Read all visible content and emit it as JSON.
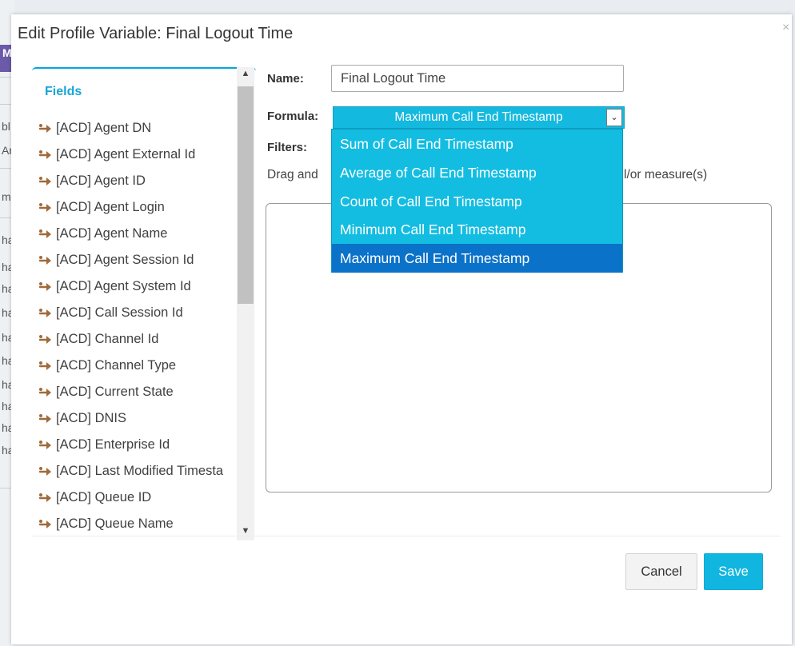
{
  "background": {
    "peek_texts": [
      "M",
      "bl",
      "Ar",
      "m",
      "ha",
      "ha",
      "ha",
      "ha",
      "ha",
      "ha",
      "ha",
      "ha",
      "ha",
      "ha"
    ]
  },
  "dialog": {
    "title": "Edit Profile Variable: Final Logout Time",
    "close_glyph": "×"
  },
  "fields": {
    "header": "Fields",
    "items": [
      "[ACD] Agent DN",
      "[ACD] Agent External Id",
      "[ACD] Agent ID",
      "[ACD] Agent Login",
      "[ACD] Agent Name",
      "[ACD] Agent Session Id",
      "[ACD] Agent System Id",
      "[ACD] Call Session Id",
      "[ACD] Channel Id",
      "[ACD] Channel Type",
      "[ACD] Current State",
      "[ACD] DNIS",
      "[ACD] Enterprise Id",
      "[ACD] Last Modified Timesta",
      "[ACD] Queue ID",
      "[ACD] Queue Name"
    ],
    "icon": "field-plug-icon",
    "icon_color": "#a06a3a"
  },
  "form": {
    "name_label": "Name:",
    "name_value": "Final Logout Time",
    "formula_label": "Formula:",
    "formula_value": "Maximum Call End Timestamp",
    "formula_options": [
      "Sum of Call End Timestamp",
      "Average of Call End Timestamp",
      "Count of Call End Timestamp",
      "Minimum Call End Timestamp",
      "Maximum Call End Timestamp"
    ],
    "formula_selected_index": 4,
    "filters_label": "Filters:",
    "filters_help_visible_start": "Drag and",
    "filters_help_visible_end": "l/or measure(s)"
  },
  "buttons": {
    "cancel": "Cancel",
    "save": "Save"
  },
  "colors": {
    "accent": "#11b6e0",
    "dropdown_bg": "#13bde2",
    "dropdown_selected": "#0b72c9",
    "fields_header": "#16a5d6"
  }
}
